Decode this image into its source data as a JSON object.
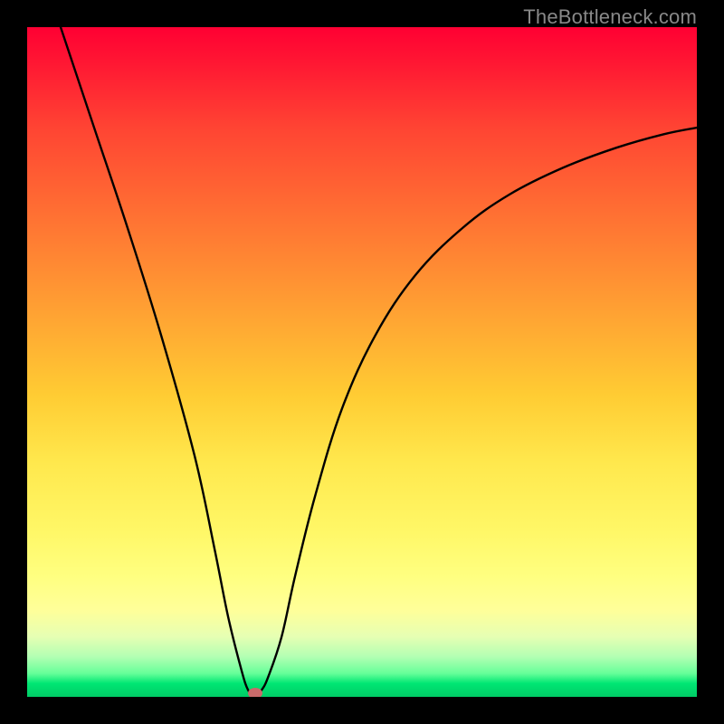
{
  "watermark": "TheBottleneck.com",
  "chart_data": {
    "type": "line",
    "title": "",
    "xlabel": "",
    "ylabel": "",
    "xlim": [
      0,
      100
    ],
    "ylim": [
      0,
      100
    ],
    "series": [
      {
        "name": "bottleneck-curve",
        "x": [
          5,
          10,
          15,
          20,
          25,
          28,
          30,
          32,
          33,
          34,
          35,
          36,
          38,
          40,
          43,
          47,
          52,
          58,
          65,
          72,
          80,
          88,
          95,
          100
        ],
        "values": [
          100,
          85,
          70,
          54,
          36,
          22,
          12,
          4,
          1,
          0,
          1,
          3,
          9,
          18,
          30,
          43,
          54,
          63,
          70,
          75,
          79,
          82,
          84,
          85
        ]
      }
    ],
    "marker": {
      "x": 34,
      "y": 0.5
    },
    "grid": false,
    "legend": false
  }
}
